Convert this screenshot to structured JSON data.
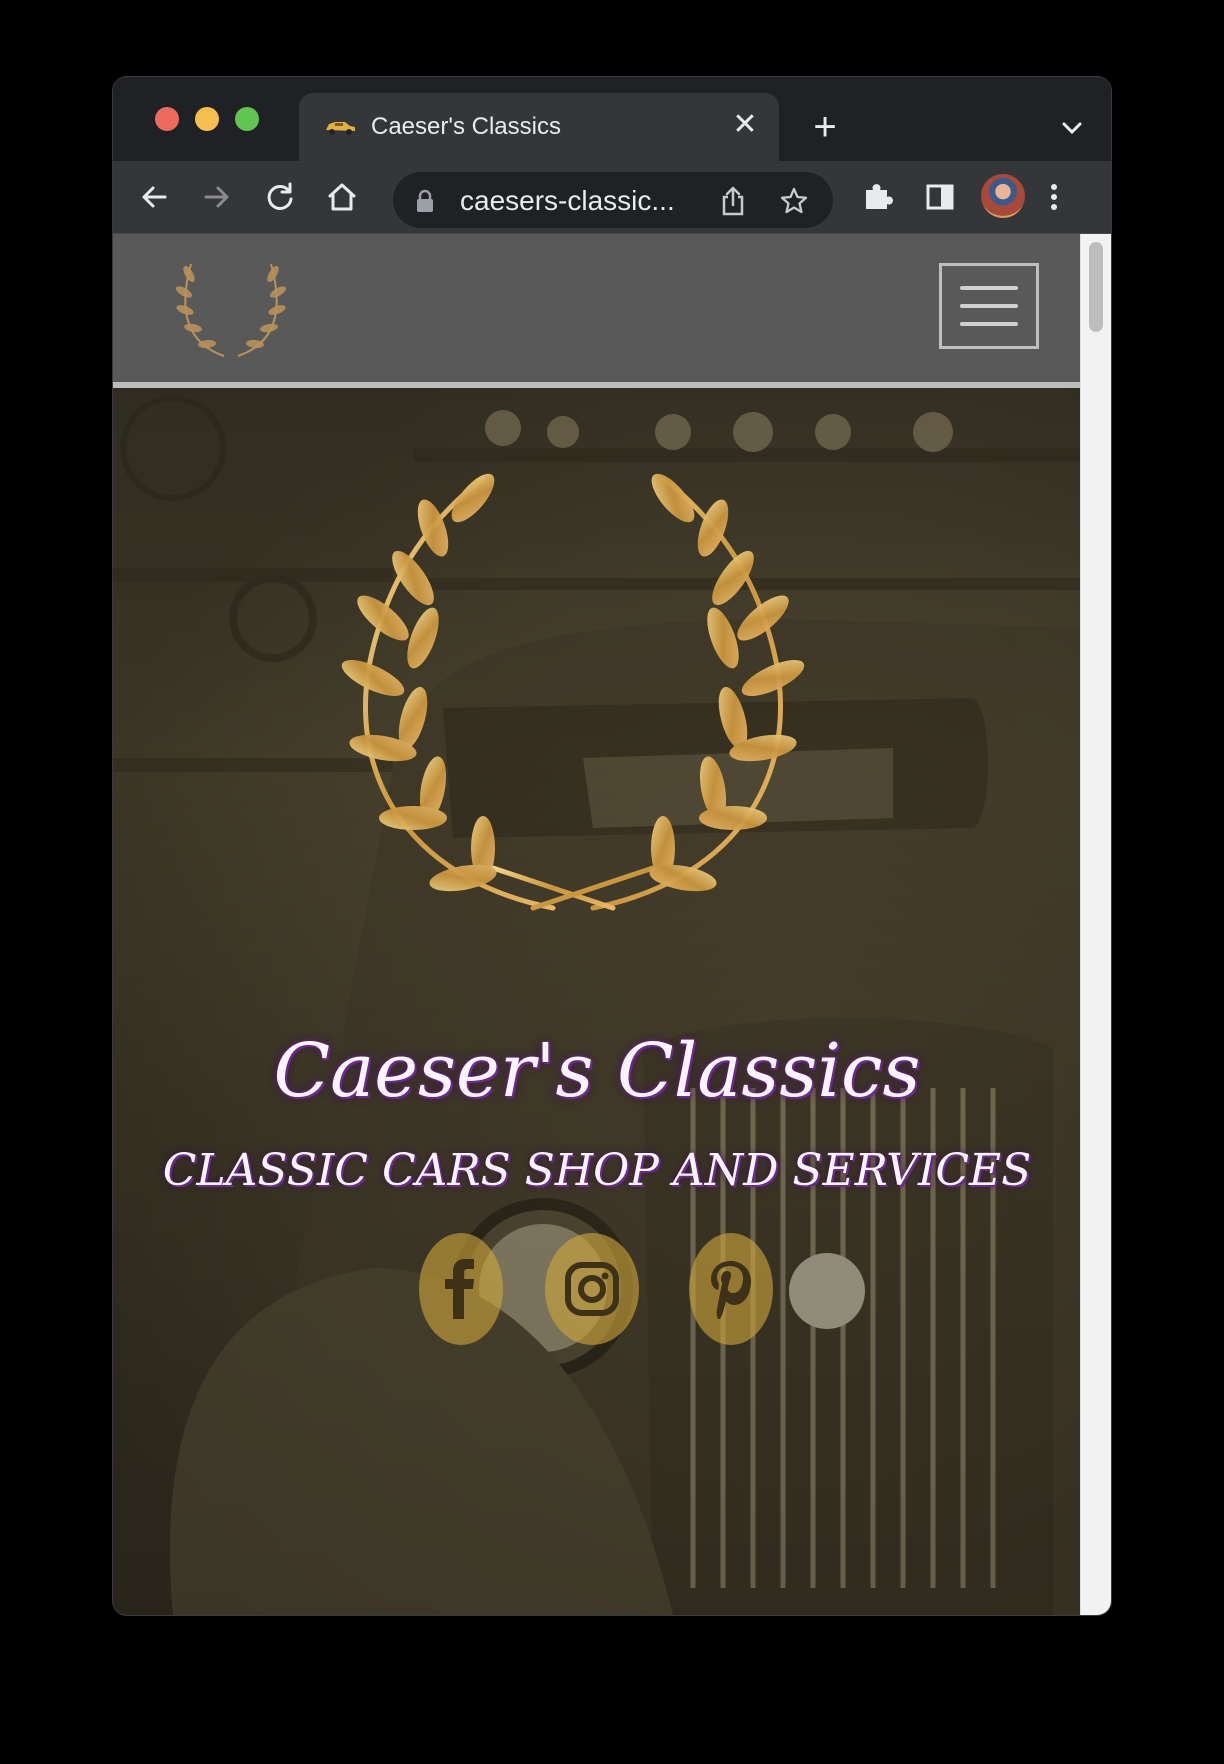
{
  "browser": {
    "tab_title": "Caeser's Classics",
    "tab_close": "✕",
    "new_tab": "+",
    "url": "caesers-classic..."
  },
  "hero": {
    "title": "Caeser's Classics",
    "subtitle": "CLASSIC CARS SHOP AND SERVICES"
  },
  "icons": {
    "back": "arrow-left-icon",
    "forward": "arrow-right-icon",
    "reload": "reload-icon",
    "home": "home-icon",
    "lock": "lock-icon",
    "share": "share-icon",
    "bookmark": "star-icon",
    "extensions": "puzzle-icon",
    "side_panel": "side-panel-icon",
    "menu": "kebab-menu-icon",
    "social": [
      "facebook-icon",
      "instagram-icon",
      "pinterest-icon"
    ]
  },
  "colors": {
    "traffic_red": "#ed6a5e",
    "traffic_yellow": "#f5bf4f",
    "traffic_green": "#61c554",
    "gold": "#c9a24a",
    "title_glow": "#6a2a8a"
  }
}
